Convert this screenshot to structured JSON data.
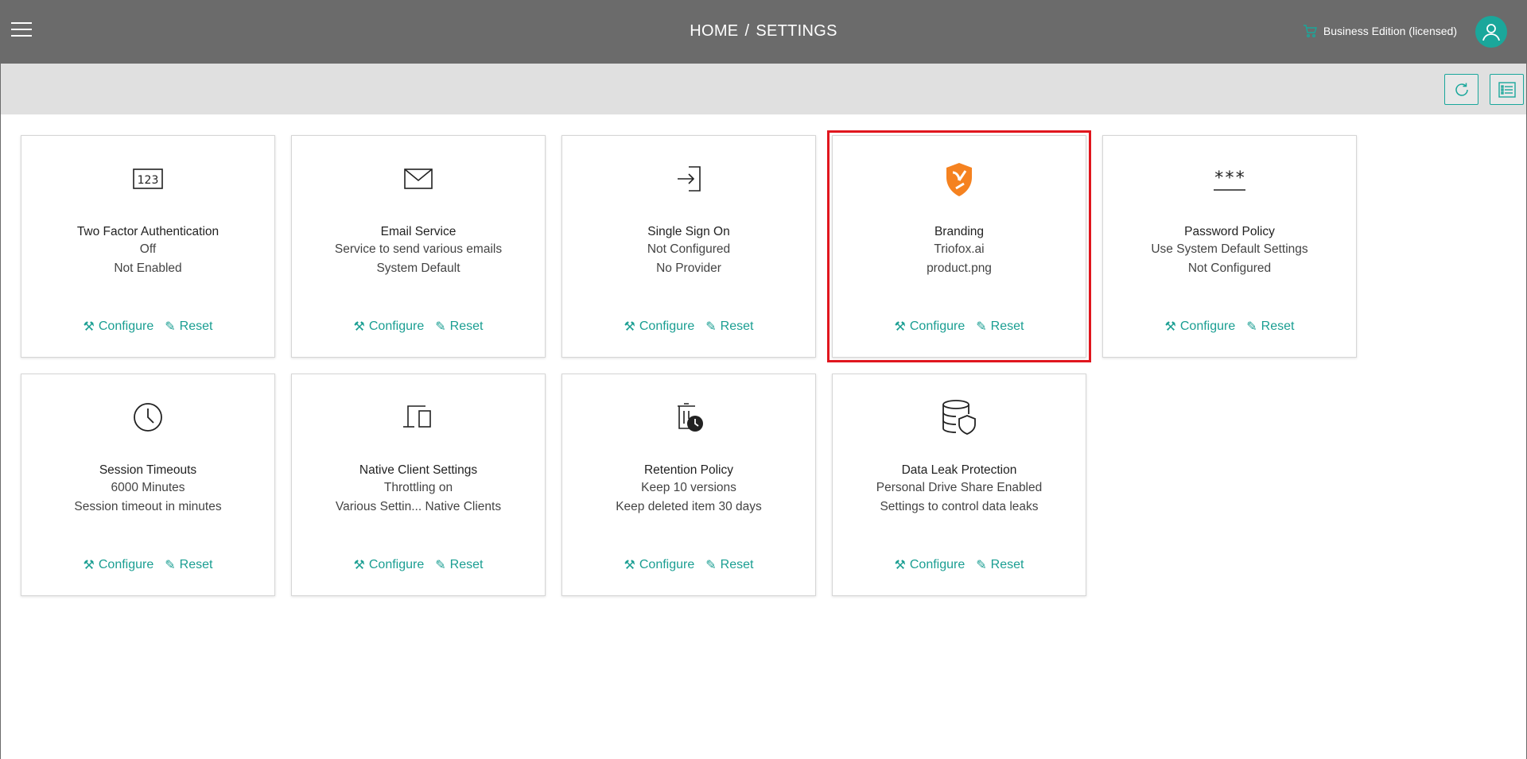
{
  "header": {
    "breadcrumb_home": "HOME",
    "breadcrumb_sep": "/",
    "breadcrumb_current": "SETTINGS",
    "edition": "Business Edition (licensed)",
    "accent_color": "#1aa79b"
  },
  "toolbar": {
    "refresh_icon": "refresh-icon",
    "list_icon": "list-view-icon"
  },
  "cards": [
    {
      "title": "Two Factor Authentication",
      "line1": "Off",
      "line2": "Not Enabled",
      "configure": "Configure",
      "reset": "Reset",
      "icon": "numeric-123-icon"
    },
    {
      "title": "Email Service",
      "line1": "Service to send various emails",
      "line2": "System Default",
      "configure": "Configure",
      "reset": "Reset",
      "icon": "envelope-icon"
    },
    {
      "title": "Single Sign On",
      "line1": "Not Configured",
      "line2": "No Provider",
      "configure": "Configure",
      "reset": "Reset",
      "icon": "sign-in-icon"
    },
    {
      "title": "Branding",
      "line1": "Triofox.ai",
      "line2": "product.png",
      "configure": "Configure",
      "reset": "Reset",
      "icon": "brand-shield-icon"
    },
    {
      "title": "Password Policy",
      "line1": "Use System Default Settings",
      "line2": "Not Configured",
      "configure": "Configure",
      "reset": "Reset",
      "icon": "password-asterisks-icon"
    },
    {
      "title": "Session Timeouts",
      "line1": "6000 Minutes",
      "line2": "Session timeout in minutes",
      "configure": "Configure",
      "reset": "Reset",
      "icon": "clock-icon"
    },
    {
      "title": "Native Client Settings",
      "line1": "Throttling on",
      "line2": "Various Settin... Native Clients",
      "configure": "Configure",
      "reset": "Reset",
      "icon": "devices-icon"
    },
    {
      "title": "Retention Policy",
      "line1": "Keep 10 versions",
      "line2": "Keep deleted item 30 days",
      "configure": "Configure",
      "reset": "Reset",
      "icon": "trash-clock-icon"
    },
    {
      "title": "Data Leak Protection",
      "line1": "Personal Drive Share Enabled",
      "line2": "Settings to control data leaks",
      "configure": "Configure",
      "reset": "Reset",
      "icon": "database-shield-icon"
    }
  ]
}
